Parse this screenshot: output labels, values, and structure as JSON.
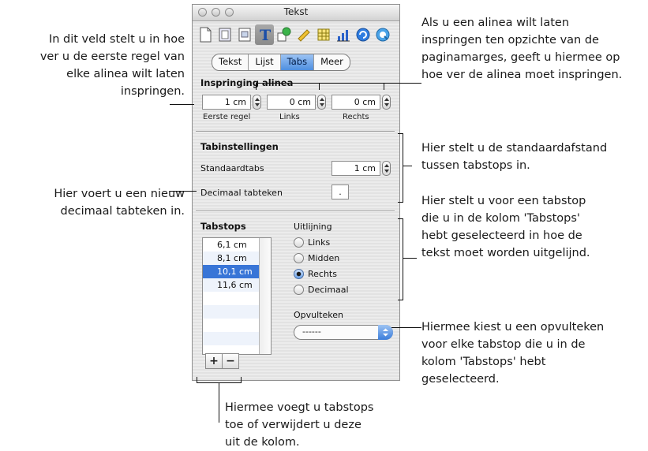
{
  "window": {
    "title": "Tekst",
    "toolbar_icons": [
      "document-icon",
      "layout-icon",
      "wrap-icon",
      "text-icon",
      "graphic-icon",
      "metrics-icon",
      "table-icon",
      "chart-icon",
      "link-icon",
      "quicktime-icon"
    ]
  },
  "tabs": [
    "Tekst",
    "Lijst",
    "Tabs",
    "Meer"
  ],
  "active_tab": "Tabs",
  "indent": {
    "heading": "Inspringing alinea",
    "first_line": {
      "value": "1 cm",
      "label": "Eerste regel"
    },
    "left": {
      "value": "0 cm",
      "label": "Links"
    },
    "right": {
      "value": "0 cm",
      "label": "Rechts"
    }
  },
  "tab_settings": {
    "heading": "Tabinstellingen",
    "default_tabs_label": "Standaardtabs",
    "default_tabs_value": "1 cm",
    "decimal_label": "Decimaal tabteken",
    "decimal_value": "."
  },
  "tabstops": {
    "heading": "Tabstops",
    "items": [
      "6,1 cm",
      "8,1 cm",
      "10,1 cm",
      "11,6 cm"
    ],
    "selected": "10,1 cm"
  },
  "alignment": {
    "heading": "Uitlijning",
    "options": [
      "Links",
      "Midden",
      "Rechts",
      "Decimaal"
    ],
    "selected": "Rechts"
  },
  "leader": {
    "heading": "Opvulteken",
    "value": "------"
  },
  "buttons": {
    "add": "+",
    "remove": "−"
  },
  "callouts": {
    "first_line": [
      "In dit veld stelt u in hoe",
      "ver u de eerste regel van",
      "elke alinea wilt laten",
      "inspringen."
    ],
    "indent": [
      "Als u een alinea wilt laten",
      "inspringen ten opzichte van de",
      "paginamarges, geeft u hiermee op",
      "hoe ver de alinea moet inspringen."
    ],
    "default_tab": [
      "Hier stelt u de standaardafstand",
      "tussen tabstops in."
    ],
    "decimal": [
      "Hier voert u een nieuw",
      "decimaal tabteken in."
    ],
    "alignment": [
      "Hier stelt u voor een tabstop",
      "die u in de kolom 'Tabstops'",
      "hebt geselecteerd in hoe de",
      "tekst moet worden uitgelijnd."
    ],
    "leader": [
      "Hiermee kiest u een opvulteken",
      "voor elke tabstop die u in de",
      "kolom 'Tabstops' hebt",
      "geselecteerd."
    ],
    "add_remove": [
      "Hiermee voegt u tabstops",
      "toe of verwijdert u deze",
      "uit de kolom."
    ]
  }
}
